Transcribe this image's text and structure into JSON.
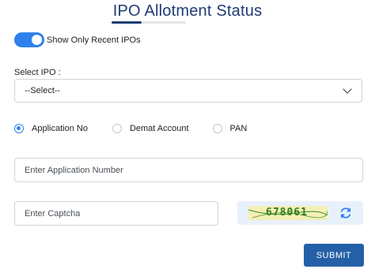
{
  "header": {
    "title": "IPO Allotment Status"
  },
  "filter": {
    "toggle_label": "Show Only Recent IPOs",
    "toggle_on": true
  },
  "ipo_select": {
    "label": "Select IPO :",
    "selected": "--Select--"
  },
  "search_type": {
    "options": [
      {
        "label": "Application No",
        "checked": true
      },
      {
        "label": "Demat Account",
        "checked": false
      },
      {
        "label": "PAN",
        "checked": false
      }
    ]
  },
  "application_input": {
    "placeholder": "Enter Application Number",
    "value": ""
  },
  "captcha": {
    "placeholder": "Enter Captcha",
    "value": "",
    "code": "678061",
    "refresh_icon": "refresh-icon"
  },
  "actions": {
    "submit_label": "SUBMIT"
  },
  "colors": {
    "primary": "#2f80ed",
    "title": "#1f3b73",
    "submit": "#2460a7",
    "captcha_bg": "#e8f1fb"
  }
}
